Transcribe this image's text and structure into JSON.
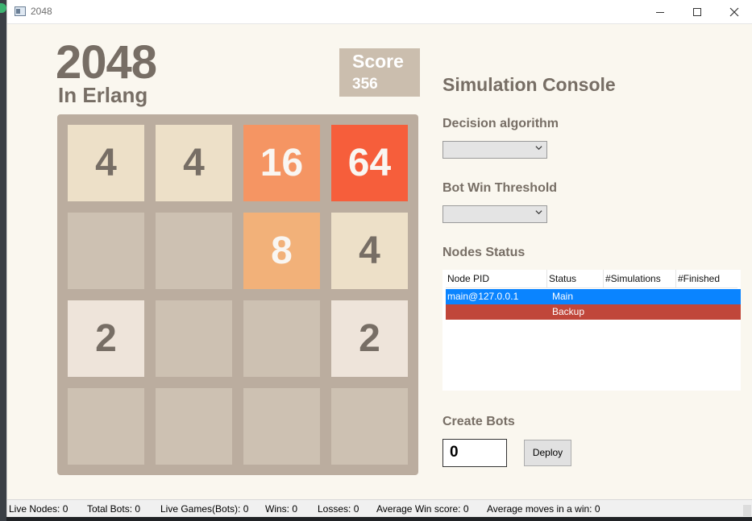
{
  "window": {
    "title": "2048"
  },
  "game": {
    "title": "2048",
    "subtitle": "In Erlang",
    "score_label": "Score",
    "score_value": "356",
    "board": [
      [
        "4",
        "4",
        "16",
        "64"
      ],
      [
        "",
        "",
        "8",
        "4"
      ],
      [
        "2",
        "",
        "",
        "2"
      ],
      [
        "",
        "",
        "",
        ""
      ]
    ]
  },
  "console": {
    "title": "Simulation Console",
    "decision_label": "Decision algorithm",
    "decision_value": "",
    "threshold_label": "Bot Win Threshold",
    "threshold_value": "",
    "nodes_label": "Nodes Status",
    "columns": [
      "Node PID",
      "Status",
      "#Simulations",
      "#Finished"
    ],
    "rows": [
      {
        "pid": "main@127.0.0.1",
        "status": "Main",
        "simulations": "",
        "finished": ""
      },
      {
        "pid": "",
        "status": "Backup",
        "simulations": "",
        "finished": ""
      }
    ],
    "create_label": "Create Bots",
    "bots_value": "0",
    "deploy_label": "Deploy"
  },
  "status_bar": {
    "live_nodes": "Live Nodes:  0",
    "total_bots": "Total Bots:  0",
    "live_games": "Live Games(Bots):  0",
    "wins": "Wins:  0",
    "losses": "Losses:  0",
    "avg_win_score": "Average Win score:  0",
    "avg_moves": "Average moves in a win:  0"
  },
  "colors": {
    "row_main": "#0a84ff",
    "row_backup": "#c0463a",
    "tile_2": "#eee4da",
    "tile_4": "#ede0c8",
    "tile_8": "#f2b179",
    "tile_16": "#f59563",
    "tile_64": "#f65e3b",
    "text_brown": "#776e65"
  }
}
